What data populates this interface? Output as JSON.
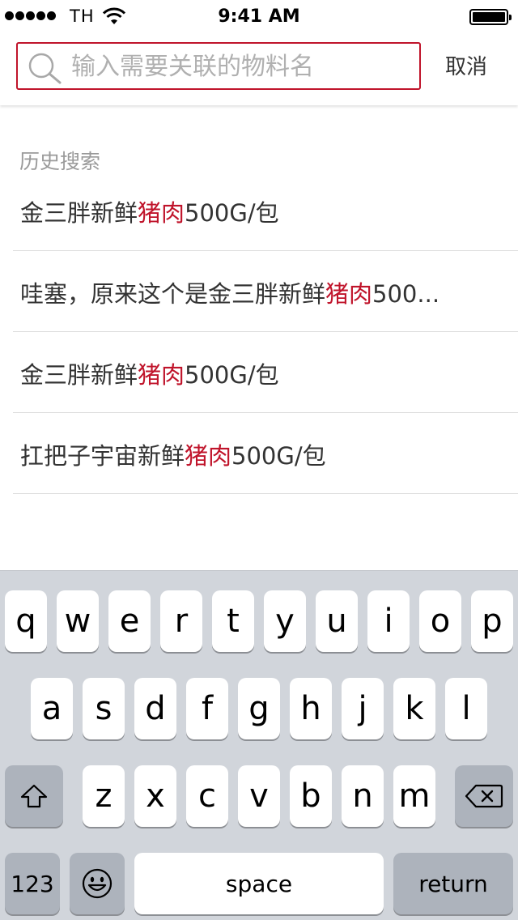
{
  "status_bar": {
    "carrier": "TH",
    "time": "9:41 AM"
  },
  "search": {
    "placeholder": "输入需要关联的物料名",
    "value": "",
    "cancel_label": "取消"
  },
  "history": {
    "title": "历史搜索",
    "items": [
      {
        "before": "金三胖新鲜",
        "highlight": "猪肉",
        "after": "500G/包"
      },
      {
        "before": "哇塞，原来这个是金三胖新鲜",
        "highlight": "猪肉",
        "after": "500..."
      },
      {
        "before": "金三胖新鲜",
        "highlight": "猪肉",
        "after": "500G/包"
      },
      {
        "before": "扛把子宇宙新鲜",
        "highlight": "猪肉",
        "after": "500G/包"
      }
    ]
  },
  "keyboard": {
    "row1": [
      "q",
      "w",
      "e",
      "r",
      "t",
      "y",
      "u",
      "i",
      "o",
      "p"
    ],
    "row2": [
      "a",
      "s",
      "d",
      "f",
      "g",
      "h",
      "j",
      "k",
      "l"
    ],
    "row3": [
      "z",
      "x",
      "c",
      "v",
      "b",
      "n",
      "m"
    ],
    "numbers_label": "123",
    "space_label": "space",
    "return_label": "return",
    "shift_icon": "shift-icon",
    "delete_icon": "delete-icon",
    "emoji_icon": "emoji-icon"
  },
  "colors": {
    "accent": "#c0142b",
    "keyboard_bg": "#d1d5db",
    "special_key": "#adb3bc"
  }
}
